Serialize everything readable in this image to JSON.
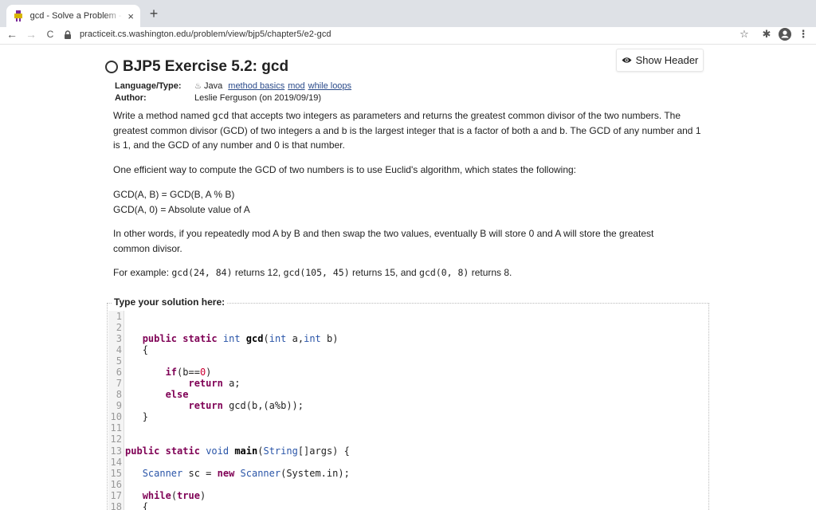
{
  "browser": {
    "tab_title": "gcd - Solve a Problem - Practi",
    "tab_close": "×",
    "new_tab": "+",
    "url": "practiceit.cs.washington.edu/problem/view/bjp5/chapter5/e2-gcd",
    "back": "←",
    "forward": "→",
    "reload": "C",
    "star": "☆",
    "extension": "✱",
    "menu": "⋮",
    "colors": {
      "tabbar": "#dee1e6",
      "tab": "#ffffff"
    }
  },
  "page": {
    "show_header_label": "Show Header",
    "title": "BJP5 Exercise 5.2: gcd",
    "meta": {
      "language_key": "Language/Type:",
      "language_value": "Java",
      "tags": [
        "method basics",
        "mod",
        "while loops"
      ],
      "author_key": "Author:",
      "author_value": "Leslie Ferguson (on 2019/09/19)"
    },
    "desc": {
      "p1_a": "Write a method named ",
      "p1_code": "gcd",
      "p1_b": " that accepts two integers as parameters and returns the greatest common divisor of the two numbers. The greatest common divisor (GCD) of two integers a and b is the largest integer that is a factor of both a and b. The GCD of any number and 1 is 1, and the GCD of any number and 0 is that number.",
      "p2": "One efficient way to compute the GCD of two numbers is to use Euclid's algorithm, which states the following:",
      "p3_line1": "GCD(A, B) = GCD(B, A % B)",
      "p3_line2": "GCD(A, 0) = Absolute value of A",
      "p4": "In other words, if you repeatedly mod A by B and then swap the two values, eventually B will store 0 and A will store the greatest common divisor.",
      "p5_a": "For example: ",
      "p5_c1": "gcd(24, 84)",
      "p5_b": " returns 12, ",
      "p5_c2": "gcd(105, 45)",
      "p5_c": " returns 15, and ",
      "p5_c3": "gcd(0, 8)",
      "p5_d": " returns 8."
    },
    "editor": {
      "legend": "Type your solution here:",
      "line_numbers": [
        "1",
        "2",
        "3",
        "4",
        "5",
        "6",
        "7",
        "8",
        "9",
        "10",
        "11",
        "12",
        "13",
        "14",
        "15",
        "16",
        "17",
        "18"
      ],
      "lines": {
        "l3": {
          "kw1": "public",
          "kw2": "static",
          "ty1": "int",
          "fn": "gcd",
          "p1": "(",
          "ty2": "int",
          "a": " a,",
          "ty3": "int",
          "b": " b)"
        },
        "l4": "{",
        "l6": {
          "kw": "if",
          "rest1": "(b==",
          "num": "0",
          "rest2": ")"
        },
        "l7": {
          "kw": "return",
          "rest": " a;"
        },
        "l8": {
          "kw": "else"
        },
        "l9": {
          "kw": "return",
          "rest": " gcd(b,(a%b));"
        },
        "l10": "}",
        "l13": {
          "kw1": "public",
          "kw2": "static",
          "ty1": "void",
          "fn": "main",
          "p1": "(",
          "ty2": "String",
          "rest": "[]args) {"
        },
        "l15": {
          "ty1": "Scanner",
          "mid": " sc = ",
          "kw": "new",
          "ty2": " Scanner",
          "rest": "(System.in);"
        },
        "l17": {
          "kw": "while",
          "p1": "(",
          "kw2": "true",
          "p2": ")"
        },
        "l18": "{"
      }
    }
  }
}
